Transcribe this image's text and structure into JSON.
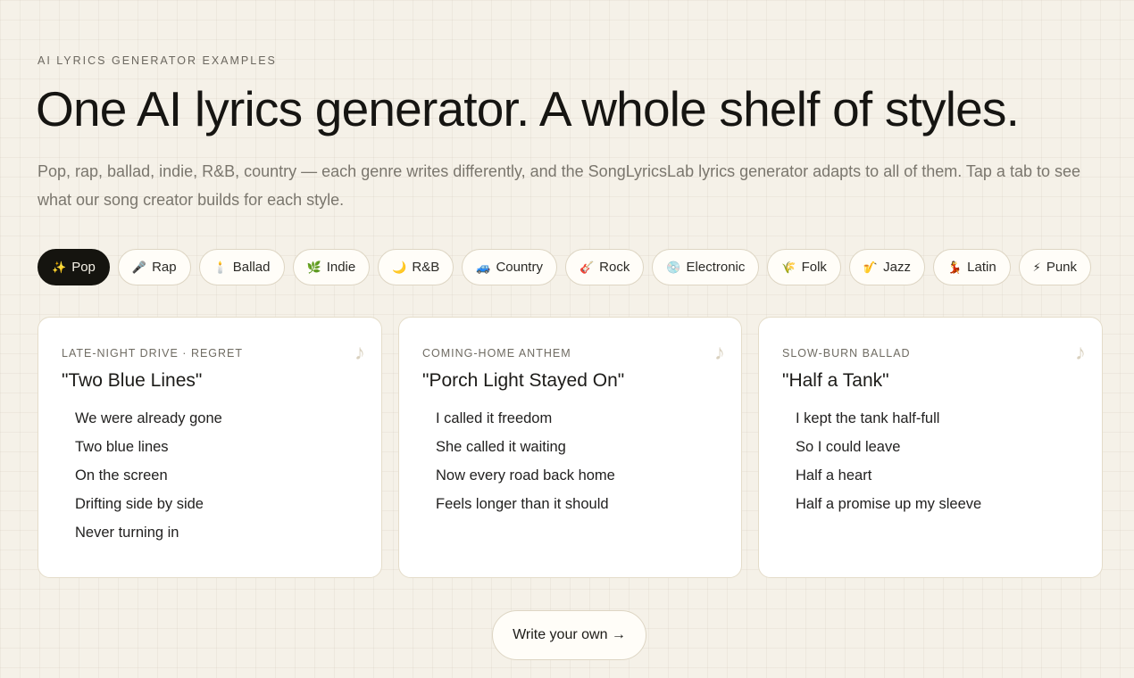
{
  "eyebrow": "AI LYRICS GENERATOR EXAMPLES",
  "title": "One AI lyrics generator. A whole shelf of styles.",
  "subtitle": "Pop, rap, ballad, indie, R&B, country — each genre writes differently, and the SongLyricsLab lyrics generator adapts to all of them. Tap a tab to see what our song creator builds for each style.",
  "tabs": [
    {
      "emoji": "✨",
      "label": "Pop"
    },
    {
      "emoji": "🎤",
      "label": "Rap"
    },
    {
      "emoji": "🕯️",
      "label": "Ballad"
    },
    {
      "emoji": "🌿",
      "label": "Indie"
    },
    {
      "emoji": "🌙",
      "label": "R&B"
    },
    {
      "emoji": "🚙",
      "label": "Country"
    },
    {
      "emoji": "🎸",
      "label": "Rock"
    },
    {
      "emoji": "💿",
      "label": "Electronic"
    },
    {
      "emoji": "🌾",
      "label": "Folk"
    },
    {
      "emoji": "🎷",
      "label": "Jazz"
    },
    {
      "emoji": "💃",
      "label": "Latin"
    },
    {
      "emoji": "⚡",
      "label": "Punk"
    }
  ],
  "active_tab": "Pop",
  "cards": [
    {
      "kicker": "LATE-NIGHT DRIVE · REGRET",
      "note": "♪",
      "title": "\"Two Blue Lines\"",
      "lines": [
        "We were already gone",
        "Two blue lines",
        "On the screen",
        "Drifting side by side",
        "Never turning in"
      ]
    },
    {
      "kicker": "COMING-HOME ANTHEM",
      "note": "♪",
      "title": "\"Porch Light Stayed On\"",
      "lines": [
        "I called it freedom",
        "She called it waiting",
        "Now every road back home",
        "Feels longer than it should"
      ]
    },
    {
      "kicker": "SLOW-BURN BALLAD",
      "note": "♪",
      "title": "\"Half a Tank\"",
      "lines": [
        "I kept the tank half-full",
        "So I could leave",
        "Half a heart",
        "Half a promise up my sleeve"
      ]
    }
  ],
  "cta": "Write your own →"
}
